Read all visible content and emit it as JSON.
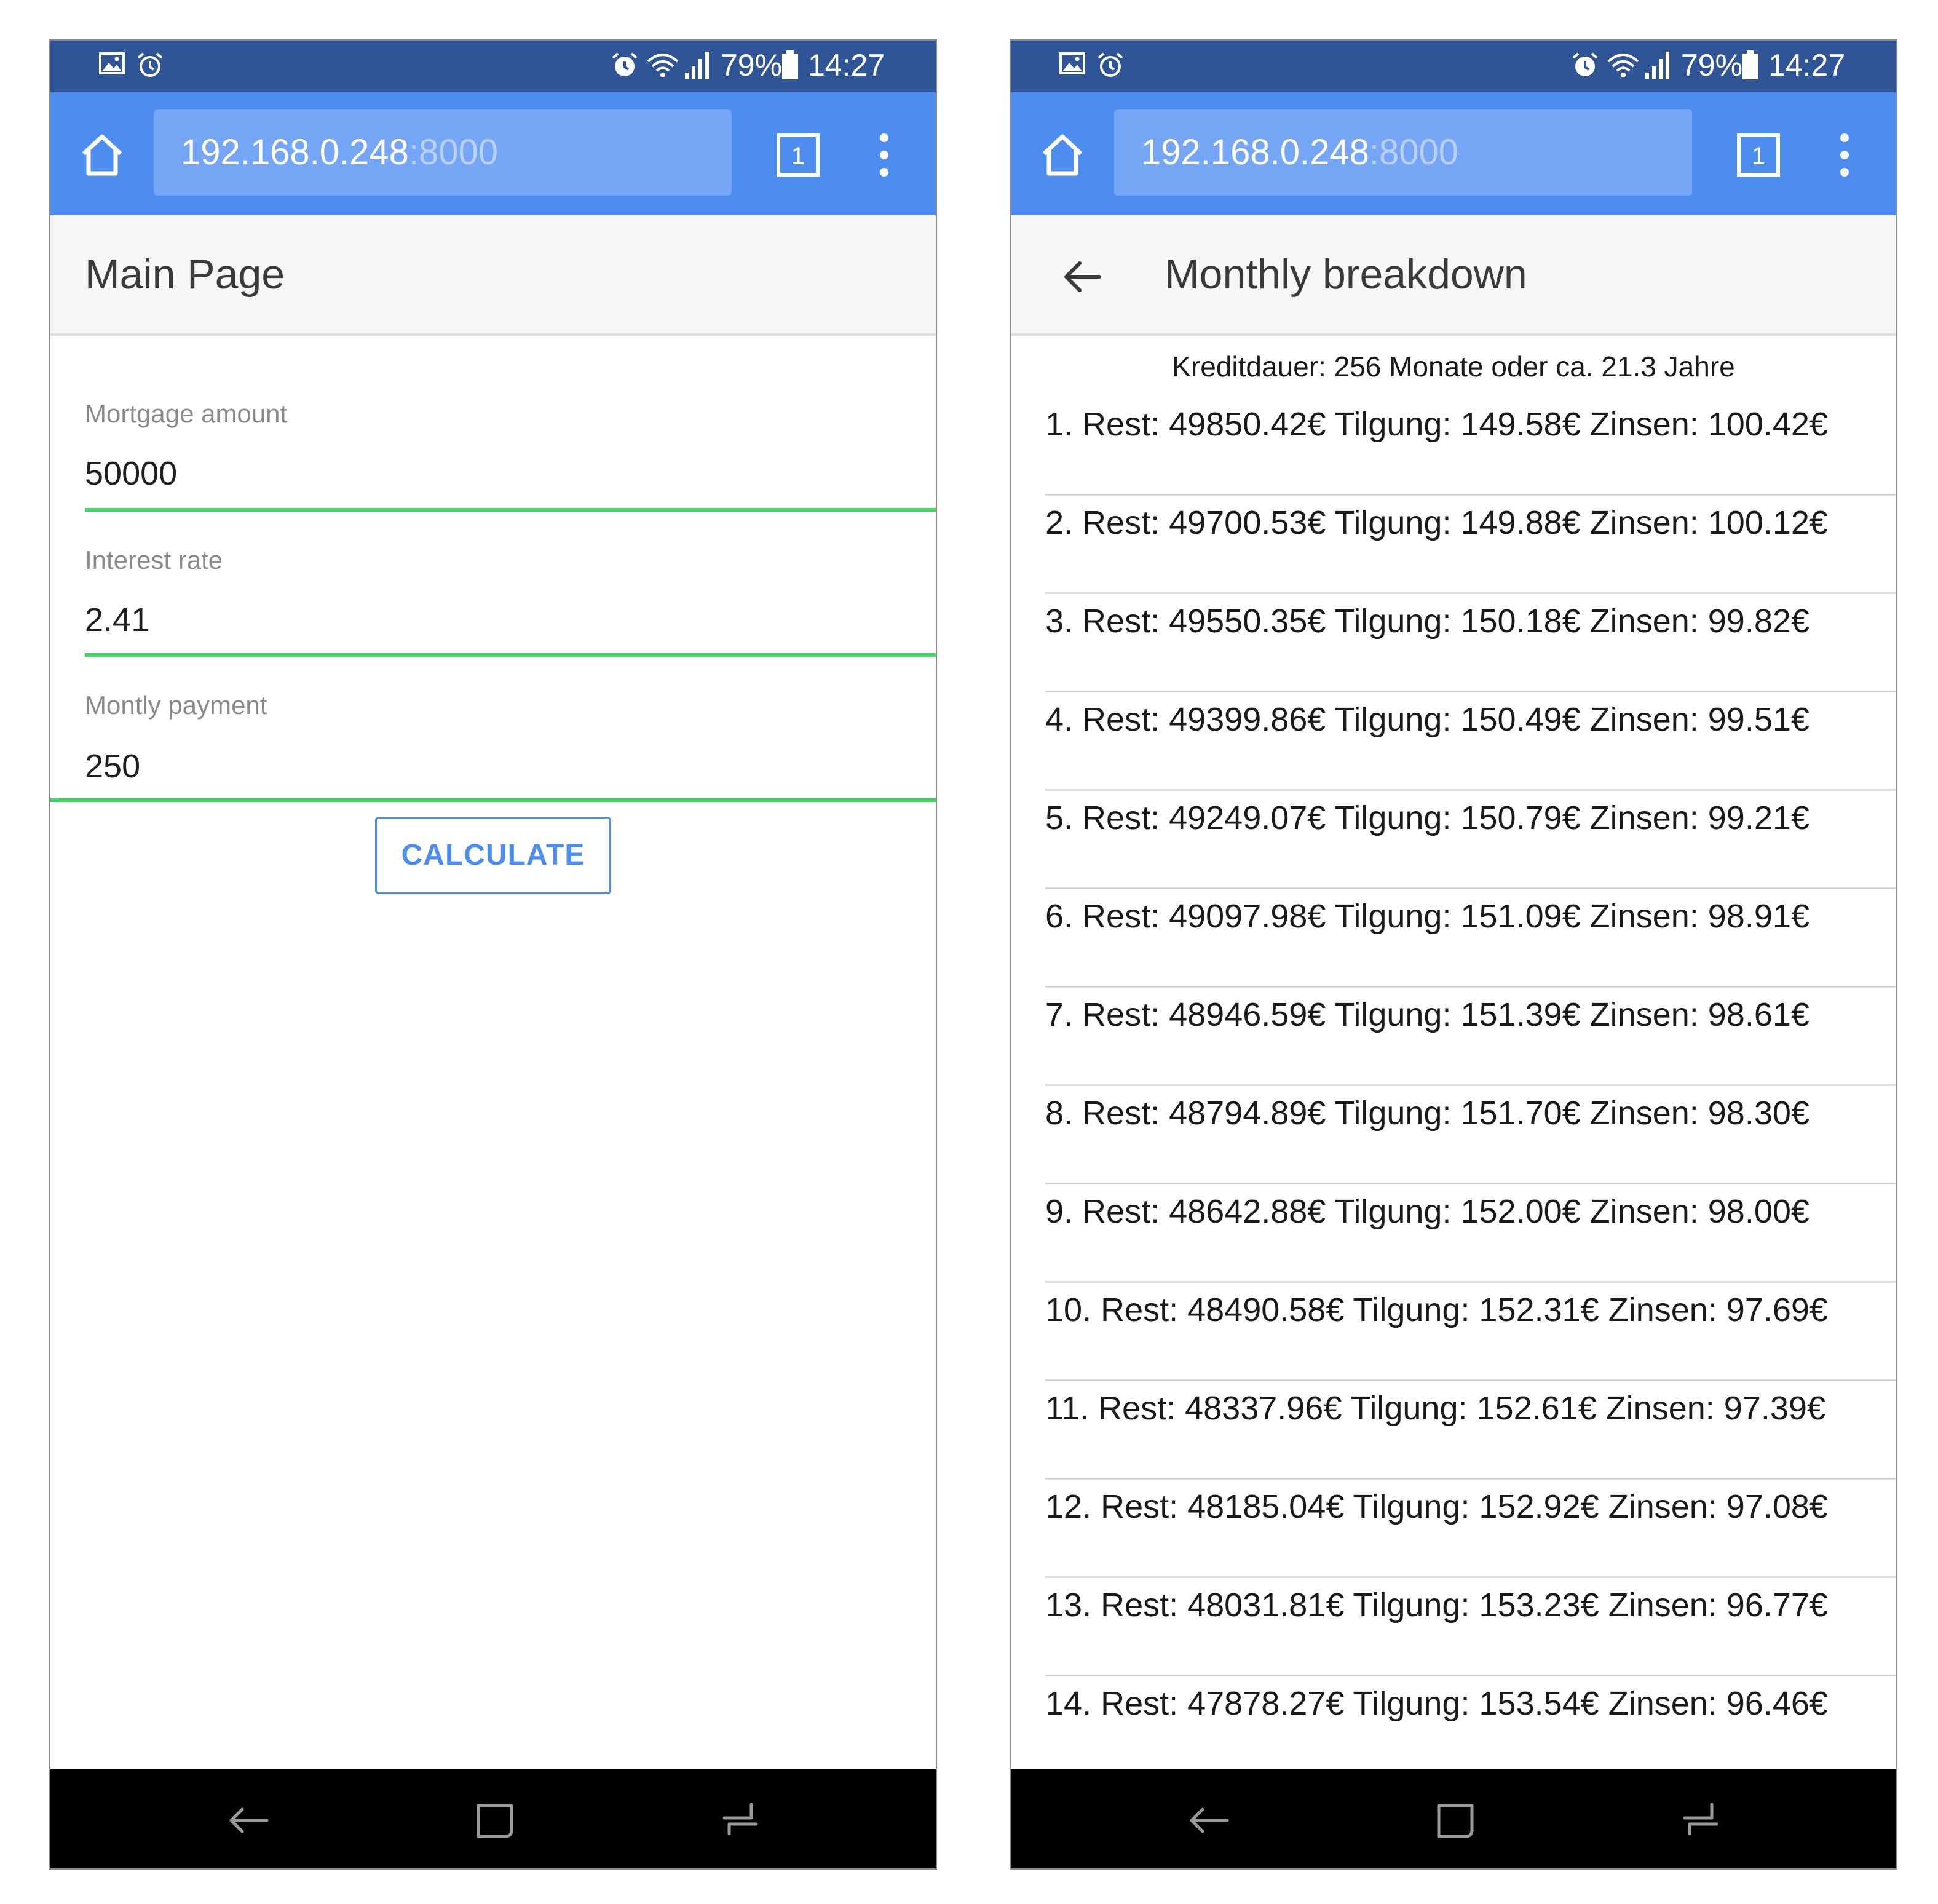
{
  "status_bar": {
    "battery": "79%",
    "time": "14:27",
    "left_icons": [
      "gallery-icon",
      "alarm-icon"
    ],
    "right_icons": [
      "alarm-icon",
      "wifi-icon",
      "signal-icon",
      "battery-icon"
    ]
  },
  "browser": {
    "url_host": "192.168.0.248",
    "url_port": ":8000",
    "tab_count": "1"
  },
  "main_page": {
    "title": "Main Page",
    "fields": [
      {
        "label": "Mortgage amount",
        "value": "50000"
      },
      {
        "label": "Interest rate",
        "value": "2.41"
      },
      {
        "label": "Montly payment",
        "value": "250"
      }
    ],
    "calculate_label": "CALCULATE"
  },
  "breakdown_page": {
    "title": "Monthly breakdown",
    "summary": "Kreditdauer: 256 Monate oder ca. 21.3 Jahre",
    "rows": [
      "1. Rest: 49850.42€ Tilgung: 149.58€ Zinsen: 100.42€",
      "2. Rest: 49700.53€ Tilgung: 149.88€ Zinsen: 100.12€",
      "3. Rest: 49550.35€ Tilgung: 150.18€ Zinsen: 99.82€",
      "4. Rest: 49399.86€ Tilgung: 150.49€ Zinsen: 99.51€",
      "5. Rest: 49249.07€ Tilgung: 150.79€ Zinsen: 99.21€",
      "6. Rest: 49097.98€ Tilgung: 151.09€ Zinsen: 98.91€",
      "7. Rest: 48946.59€ Tilgung: 151.39€ Zinsen: 98.61€",
      "8. Rest: 48794.89€ Tilgung: 151.70€ Zinsen: 98.30€",
      "9. Rest: 48642.88€ Tilgung: 152.00€ Zinsen: 98.00€",
      "10. Rest: 48490.58€ Tilgung: 152.31€ Zinsen: 97.69€",
      "11. Rest: 48337.96€ Tilgung: 152.61€ Zinsen: 97.39€",
      "12. Rest: 48185.04€ Tilgung: 152.92€ Zinsen: 97.08€",
      "13. Rest: 48031.81€ Tilgung: 153.23€ Zinsen: 96.77€",
      "14. Rest: 47878.27€ Tilgung: 153.54€ Zinsen: 96.46€"
    ]
  },
  "colors": {
    "status_bar": "#2f5596",
    "browser_bar": "#4e8df0",
    "url_box": "#75a6f5",
    "field_underline": "#3fd35f",
    "accent": "#4e8df0"
  }
}
